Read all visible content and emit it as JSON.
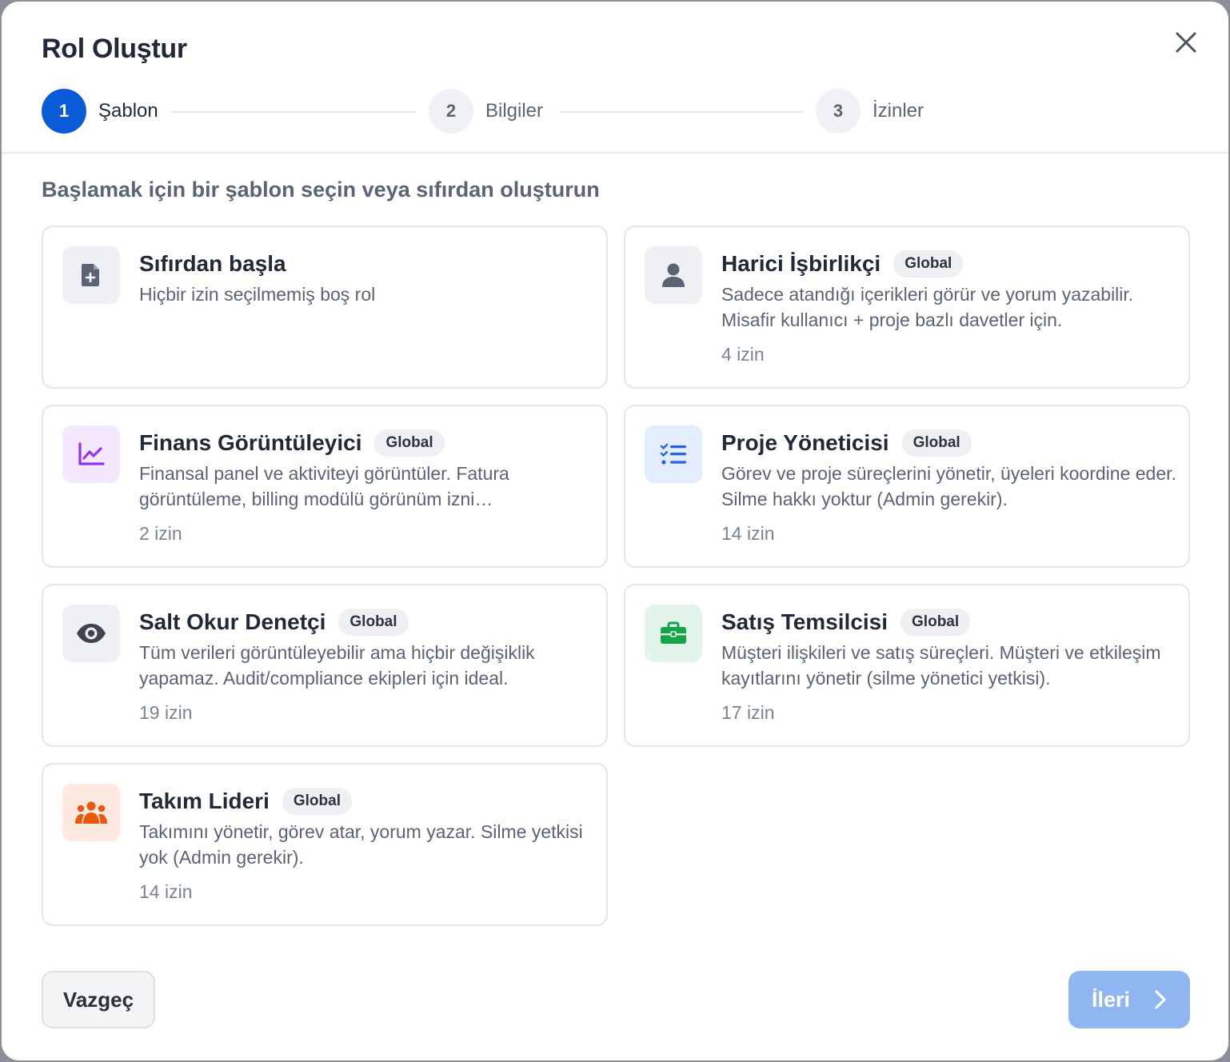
{
  "dialog": {
    "title": "Rol Oluştur",
    "close_icon": "close-icon"
  },
  "stepper": [
    {
      "number": "1",
      "label": "Şablon",
      "active": true
    },
    {
      "number": "2",
      "label": "Bilgiler",
      "active": false
    },
    {
      "number": "3",
      "label": "İzinler",
      "active": false
    }
  ],
  "subtitle": "Başlamak için bir şablon seçin veya sıfırdan oluşturun",
  "templates": [
    {
      "title": "Sıfırdan başla",
      "badge": "",
      "description": "Hiçbir izin seçilmemiş boş rol",
      "count": "",
      "icon": "file-plus-icon",
      "icon_bg": "#eef0f3",
      "icon_color": "#5a6475"
    },
    {
      "title": "Harici İşbirlikçi",
      "badge": "Global",
      "description": "Sadece atandığı içerikleri görür ve yorum yazabilir. Misafir kullanıcı + proje bazlı davetler için.",
      "count": "4 izin",
      "icon": "user-icon",
      "icon_bg": "#eef0f3",
      "icon_color": "#5a6475"
    },
    {
      "title": "Finans Görüntüleyici",
      "badge": "Global",
      "description": "Finansal panel ve aktiviteyi görüntüler. Fatura görüntüleme, billing modülü görünüm izni…",
      "count": "2 izin",
      "icon": "chart-line-icon",
      "icon_bg": "#f3e8fd",
      "icon_color": "#9333ea"
    },
    {
      "title": "Proje Yöneticisi",
      "badge": "Global",
      "description": "Görev ve proje süreçlerini yönetir, üyeleri koordine eder. Silme hakkı yoktur (Admin gerekir).",
      "count": "14 izin",
      "icon": "list-check-icon",
      "icon_bg": "#e3edfd",
      "icon_color": "#2563eb"
    },
    {
      "title": "Salt Okur Denetçi",
      "badge": "Global",
      "description": "Tüm verileri görüntüleyebilir ama hiçbir değişiklik yapamaz. Audit/compliance ekipleri için ideal.",
      "count": "19 izin",
      "icon": "eye-icon",
      "icon_bg": "#eef0f3",
      "icon_color": "#3d4552"
    },
    {
      "title": "Satış Temsilcisi",
      "badge": "Global",
      "description": "Müşteri ilişkileri ve satış süreçleri. Müşteri ve etkileşim kayıtlarını yönetir (silme yönetici yetkisi).",
      "count": "17 izin",
      "icon": "briefcase-icon",
      "icon_bg": "#e3f5ea",
      "icon_color": "#16a34a"
    },
    {
      "title": "Takım Lideri",
      "badge": "Global",
      "description": "Takımını yönetir, görev atar, yorum yazar. Silme yetkisi yok (Admin gerekir).",
      "count": "14 izin",
      "icon": "users-icon",
      "icon_bg": "#fde9df",
      "icon_color": "#ea580c"
    }
  ],
  "footer": {
    "cancel_label": "Vazgeç",
    "next_label": "İleri",
    "next_icon": "chevron-right-icon"
  }
}
